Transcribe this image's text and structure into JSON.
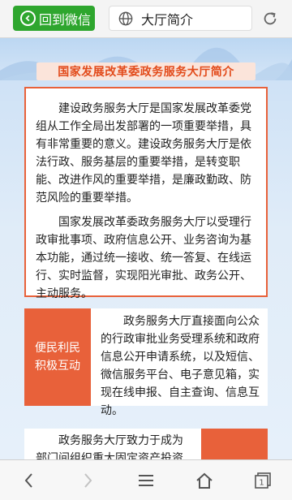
{
  "topbar": {
    "back_label": "回到微信",
    "address_title": "大厅简介"
  },
  "section_title": "国家发展改革委政务服务大厅简介",
  "intro": {
    "paragraphs": [
      "建设政务服务大厅是国家发展改革委党组从工作全局出发部署的一项重要举措，具有非常重要的意义。建设政务服务大厅是依法行政、服务基层的重要举措，是转变职能、改进作风的重要举措，是廉政勤政、防范风险的重要举措。",
      "国家发展改革委政务服务大厅以受理行政审批事项、政府信息公开、业务咨询为基本功能，通过统一接收、统一答复、在线运行、实时监督，实现阳光审批、政务公开、主动服务。"
    ]
  },
  "cards": [
    {
      "tag_line1": "便民利民",
      "tag_line2": "积极互动",
      "text": "政务服务大厅直接面向公众的行政审批业务受理系统和政府信息公开申请系统，以及短信、微信服务平台、电子意见箱，实现在线申报、自主查询、信息互动。"
    },
    {
      "text": "政务服务大厅致力于成为部门间组织重大固定资产投资项目"
    }
  ],
  "icons": {
    "back": "back-arrow-circle-icon",
    "globe": "globe-icon",
    "refresh": "refresh-icon",
    "nav_back": "chevron-left-icon",
    "nav_forward": "chevron-right-icon",
    "menu": "menu-icon",
    "home": "home-icon",
    "tabs": "tabs-icon"
  },
  "tabs_count": "1",
  "colors": {
    "wechat_green": "#2ea62e",
    "accent_orange": "#e8613a",
    "title_red": "#e24a1a"
  }
}
